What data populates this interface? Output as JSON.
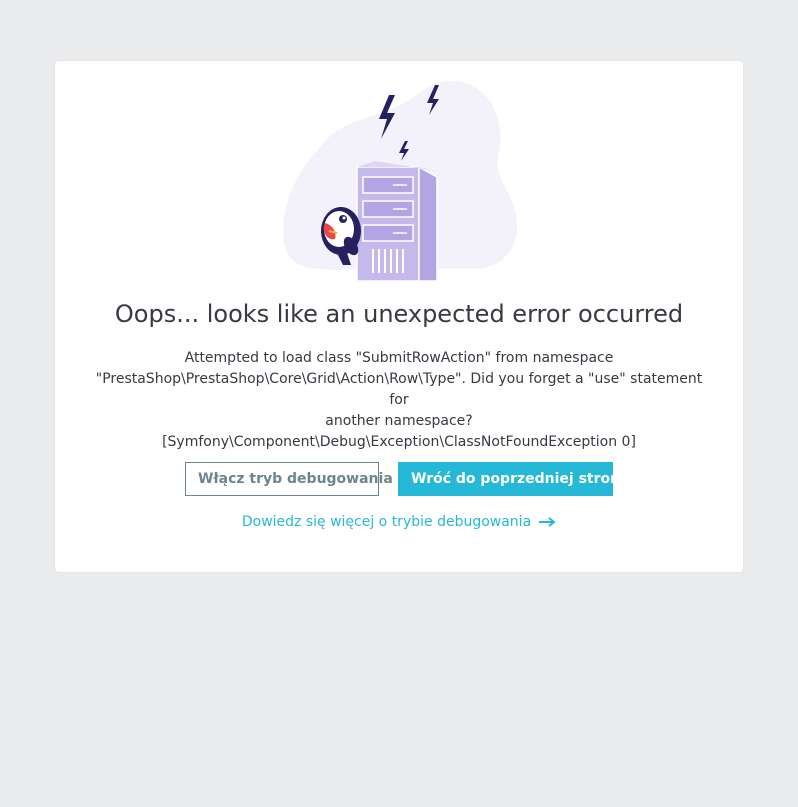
{
  "error": {
    "title": "Oops... looks like an unexpected error occurred",
    "message_lines": [
      "Attempted to load class \"SubmitRowAction\" from namespace",
      "\"PrestaShop\\PrestaShop\\Core\\Grid\\Action\\Row\\Type\". Did you forget a \"use\" statement for",
      "another namespace?",
      "[Symfony\\Component\\Debug\\Exception\\ClassNotFoundException 0]"
    ]
  },
  "actions": {
    "debug_button_label": "Włącz tryb debugowania",
    "back_button_label": "Wróć do poprzedniej strony",
    "learn_more_label": "Dowiedz się więcej o trybie debugowania"
  },
  "colors": {
    "background": "#eaebec",
    "card": "#ffffff",
    "accent": "#25b9d7",
    "text": "#363a41",
    "outline_button": "#6c868e",
    "server": "#c5b9ec",
    "bolt": "#25205f"
  },
  "icons": {
    "illustration": "broken-server-puffin-illustration",
    "arrow": "arrow-right-icon"
  }
}
